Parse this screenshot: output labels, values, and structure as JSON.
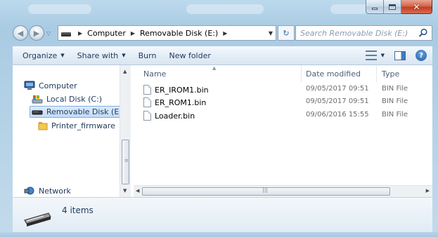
{
  "window": {
    "caption_buttons": {
      "minimize": "minimize",
      "maximize": "maximize",
      "close": "close"
    }
  },
  "nav": {
    "back_icon": "back-arrow-icon",
    "forward_icon": "forward-arrow-icon"
  },
  "address": {
    "crumbs": [
      "Computer",
      "Removable Disk (E:)"
    ],
    "search_placeholder": "Search Removable Disk (E:)"
  },
  "toolbar": {
    "organize": "Organize",
    "share_with": "Share with",
    "burn": "Burn",
    "new_folder": "New folder"
  },
  "sidebar": {
    "items": [
      {
        "label": "Computer",
        "icon": "computer-icon"
      },
      {
        "label": "Local Disk (C:)",
        "icon": "local-disk-icon"
      },
      {
        "label": "Removable Disk (E:)",
        "icon": "removable-disk-icon",
        "selected": true
      },
      {
        "label": "Printer_firmware",
        "icon": "folder-icon"
      },
      {
        "label": "Network",
        "icon": "network-icon"
      }
    ]
  },
  "files": {
    "columns": [
      "Name",
      "Date modified",
      "Type"
    ],
    "rows": [
      {
        "name": "ER_IROM1.bin",
        "date": "09/05/2017 09:51",
        "type": "BIN File"
      },
      {
        "name": "ER_ROM1.bin",
        "date": "09/05/2017 09:51",
        "type": "BIN File"
      },
      {
        "name": "Loader.bin",
        "date": "09/06/2016 15:55",
        "type": "BIN File"
      }
    ]
  },
  "status": {
    "item_count": "4 items"
  }
}
